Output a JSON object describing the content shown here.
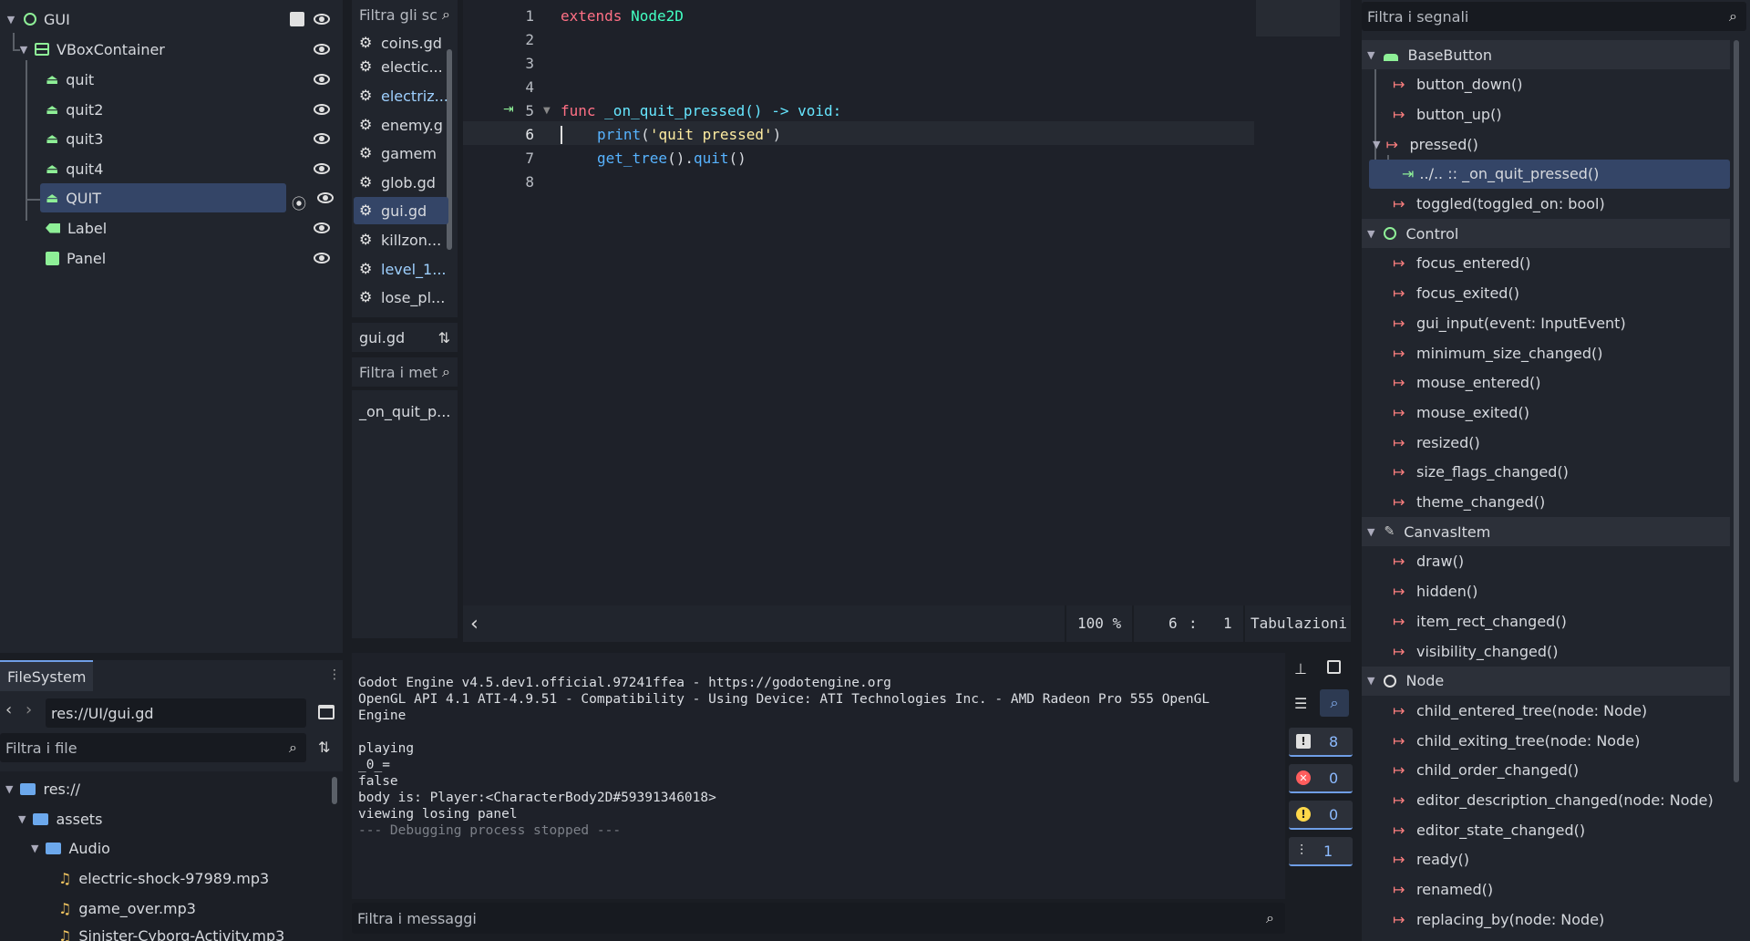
{
  "scene": {
    "nodes": [
      {
        "label": "GUI"
      },
      {
        "label": "VBoxContainer"
      },
      {
        "label": "quit"
      },
      {
        "label": "quit2"
      },
      {
        "label": "quit3"
      },
      {
        "label": "quit4"
      },
      {
        "label": "QUIT"
      },
      {
        "label": "Label"
      },
      {
        "label": "Panel"
      }
    ]
  },
  "scripts": {
    "filter_placeholder": "Filtra gli sc",
    "items": [
      "coins.gd",
      "electic...",
      "electriz...",
      "enemy.g",
      "gamem",
      "glob.gd",
      "gui.gd",
      "killzon...",
      "level_1...",
      "lose_pl..."
    ],
    "current": "gui.gd",
    "methods_filter": "Filtra i met",
    "methods": [
      "_on_quit_p..."
    ]
  },
  "editor": {
    "lines": [
      {
        "n": "1"
      },
      {
        "n": "2"
      },
      {
        "n": "3"
      },
      {
        "n": "4"
      },
      {
        "n": "5"
      },
      {
        "n": "6"
      },
      {
        "n": "7"
      },
      {
        "n": "8"
      }
    ],
    "code": {
      "l1_kw": "extends",
      "l1_ty": "Node2D",
      "l5_kw": "func",
      "l5_fn": "_on_quit_pressed",
      "l5_rest": "() -> ",
      "l5_ret": "void",
      "l6_fn": "print",
      "l6_open": "(",
      "l6_str": "'quit pressed'",
      "l6_close": ")",
      "l7_fn": "get_tree",
      "l7_mid": "().",
      "l7_fn2": "quit",
      "l7_end": "()"
    },
    "status": {
      "zoom": "100 %",
      "line": "6",
      "sep": ":",
      "col": "1",
      "indent": "Tabulazioni"
    }
  },
  "console": {
    "lines": [
      "Godot Engine v4.5.dev1.official.97241ffea - https://godotengine.org",
      "OpenGL API 4.1 ATI-4.9.51 - Compatibility - Using Device: ATI Technologies Inc. - AMD Radeon Pro 555 OpenGL",
      "Engine",
      "",
      "playing",
      "_0_=",
      "false",
      "body is: Player:<CharacterBody2D#59391346018>",
      "viewing losing panel"
    ],
    "stopped": "--- Debugging process stopped ---",
    "filter_placeholder": "Filtra i messaggi",
    "counts": {
      "messages": "8",
      "errors": "0",
      "warnings": "0",
      "debug": "1"
    }
  },
  "filesystem": {
    "tab": "FileSystem",
    "path": "res://UI/gui.gd",
    "filter_placeholder": "Filtra i file",
    "items": [
      "res://",
      "assets",
      "Audio",
      "electric-shock-97989.mp3",
      "game_over.mp3",
      "Sinister-Cyborg-Activity.mp3"
    ]
  },
  "signals": {
    "filter_placeholder": "Filtra i segnali",
    "sections": {
      "basebutton": "BaseButton",
      "control": "Control",
      "canvasitem": "CanvasItem",
      "node": "Node"
    },
    "basebutton": [
      "button_down()",
      "button_up()",
      "pressed()"
    ],
    "connection": "../.. :: _on_quit_pressed()",
    "toggled": "toggled(toggled_on: bool)",
    "control": [
      "focus_entered()",
      "focus_exited()",
      "gui_input(event: InputEvent)",
      "minimum_size_changed()",
      "mouse_entered()",
      "mouse_exited()",
      "resized()",
      "size_flags_changed()",
      "theme_changed()"
    ],
    "canvasitem": [
      "draw()",
      "hidden()",
      "item_rect_changed()",
      "visibility_changed()"
    ],
    "node": [
      "child_entered_tree(node: Node)",
      "child_exiting_tree(node: Node)",
      "child_order_changed()",
      "editor_description_changed(node: Node)",
      "editor_state_changed()",
      "ready()",
      "renamed()",
      "replacing_by(node: Node)"
    ]
  }
}
